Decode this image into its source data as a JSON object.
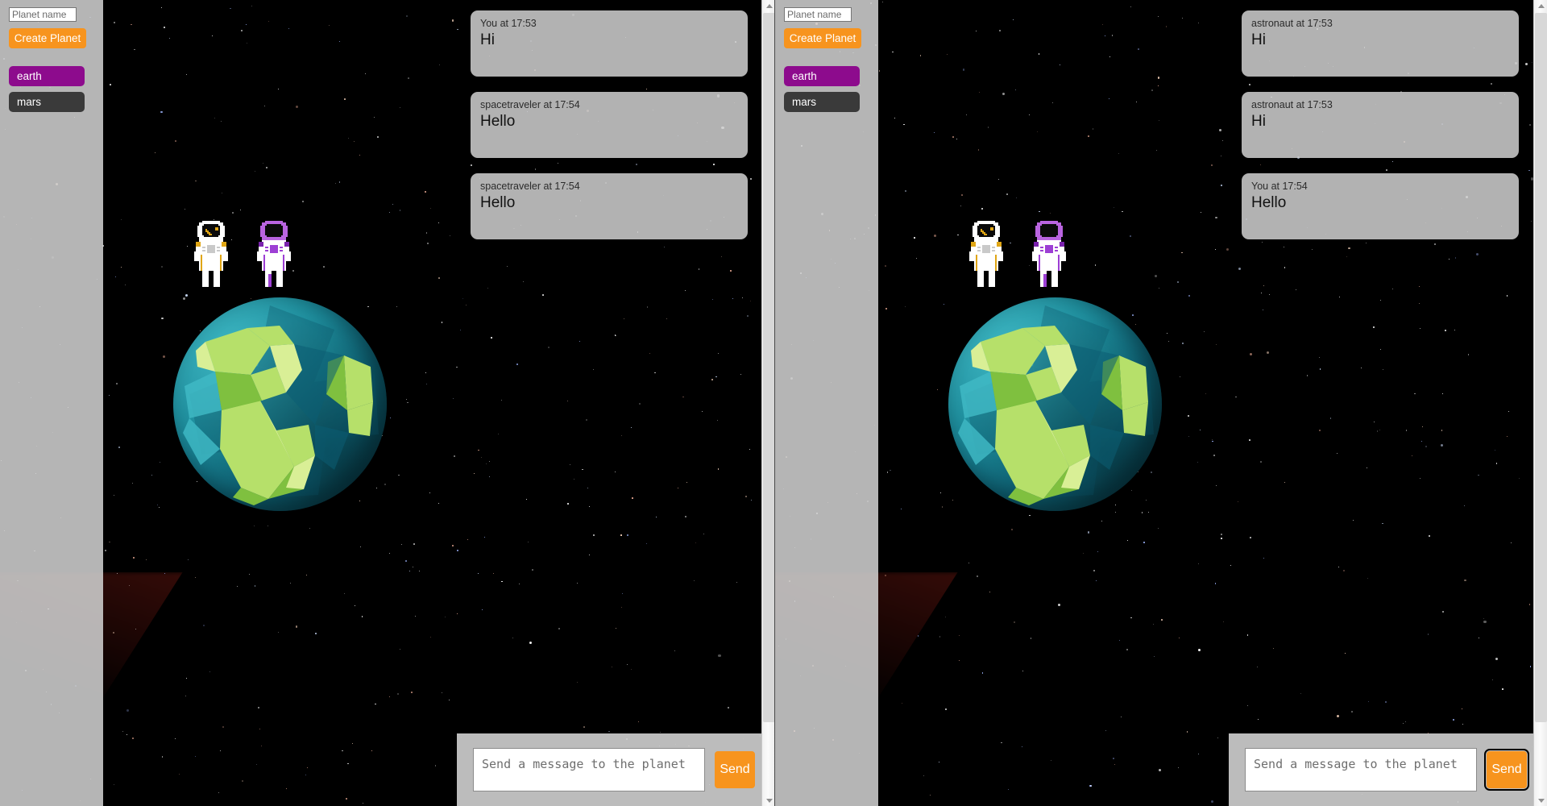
{
  "app": {
    "accent_orange": "#f7941e",
    "active_planet_purple": "#8d0b8d",
    "inactive_planet_gray": "#3a3a3a",
    "space_background": "#000000"
  },
  "sidebar": {
    "planet_name_input": {
      "placeholder": "Planet name",
      "value": ""
    },
    "create_button_label": "Create Planet",
    "planets": [
      {
        "label": "earth",
        "state": "active"
      },
      {
        "label": "mars",
        "state": "inactive"
      }
    ]
  },
  "left_pane": {
    "messages": [
      {
        "meta": "You at 17:53",
        "body": "Hi"
      },
      {
        "meta": "spacetraveler at 17:54",
        "body": "Hello"
      },
      {
        "meta": "spacetraveler at 17:54",
        "body": "Hello"
      }
    ],
    "composer": {
      "placeholder": "Send a message to the planet",
      "value": "",
      "send_label": "Send"
    }
  },
  "right_pane": {
    "messages": [
      {
        "meta": "astronaut at 17:53",
        "body": "Hi"
      },
      {
        "meta": "astronaut at 17:53",
        "body": "Hi"
      },
      {
        "meta": "You at 17:54",
        "body": "Hello"
      }
    ],
    "composer": {
      "placeholder": "Send a message to the planet",
      "value": "",
      "send_label": "Send"
    }
  },
  "scene": {
    "planet_name": "earth",
    "avatars": [
      {
        "name": "astronaut-white-orange"
      },
      {
        "name": "astronaut-white-purple"
      }
    ]
  }
}
